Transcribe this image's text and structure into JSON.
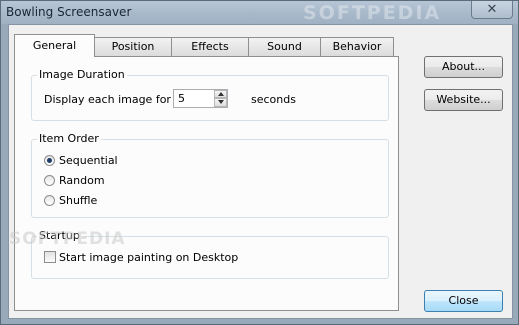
{
  "window": {
    "title": "Bowling Screensaver",
    "close_glyph": "✕"
  },
  "watermark": {
    "title_text": "SOFTPEDIA",
    "body_text": "SOFTPEDIA"
  },
  "tabs": [
    {
      "label": "General",
      "active": true
    },
    {
      "label": "Position",
      "active": false
    },
    {
      "label": "Effects",
      "active": false
    },
    {
      "label": "Sound",
      "active": false
    },
    {
      "label": "Behavior",
      "active": false
    }
  ],
  "image_duration": {
    "group_label": "Image Duration",
    "prefix_label": "Display each image for",
    "value": "5",
    "suffix_label": "seconds"
  },
  "item_order": {
    "group_label": "Item Order",
    "options": [
      {
        "label": "Sequential",
        "selected": true
      },
      {
        "label": "Random",
        "selected": false
      },
      {
        "label": "Shuffle",
        "selected": false
      }
    ]
  },
  "startup": {
    "group_label": "Startup",
    "checkbox_label": "Start image painting on Desktop",
    "checked": false
  },
  "buttons": {
    "about": "About...",
    "website": "Website...",
    "close": "Close"
  },
  "icons": {
    "close": "close-icon",
    "spin_up": "arrow-up-icon",
    "spin_down": "arrow-down-icon"
  },
  "colors": {
    "window_frame": "#98a9ba",
    "client_bg": "#f0f0f0",
    "tab_panel_bg": "#fcfcfc",
    "default_button_border": "#3c7fb1"
  }
}
